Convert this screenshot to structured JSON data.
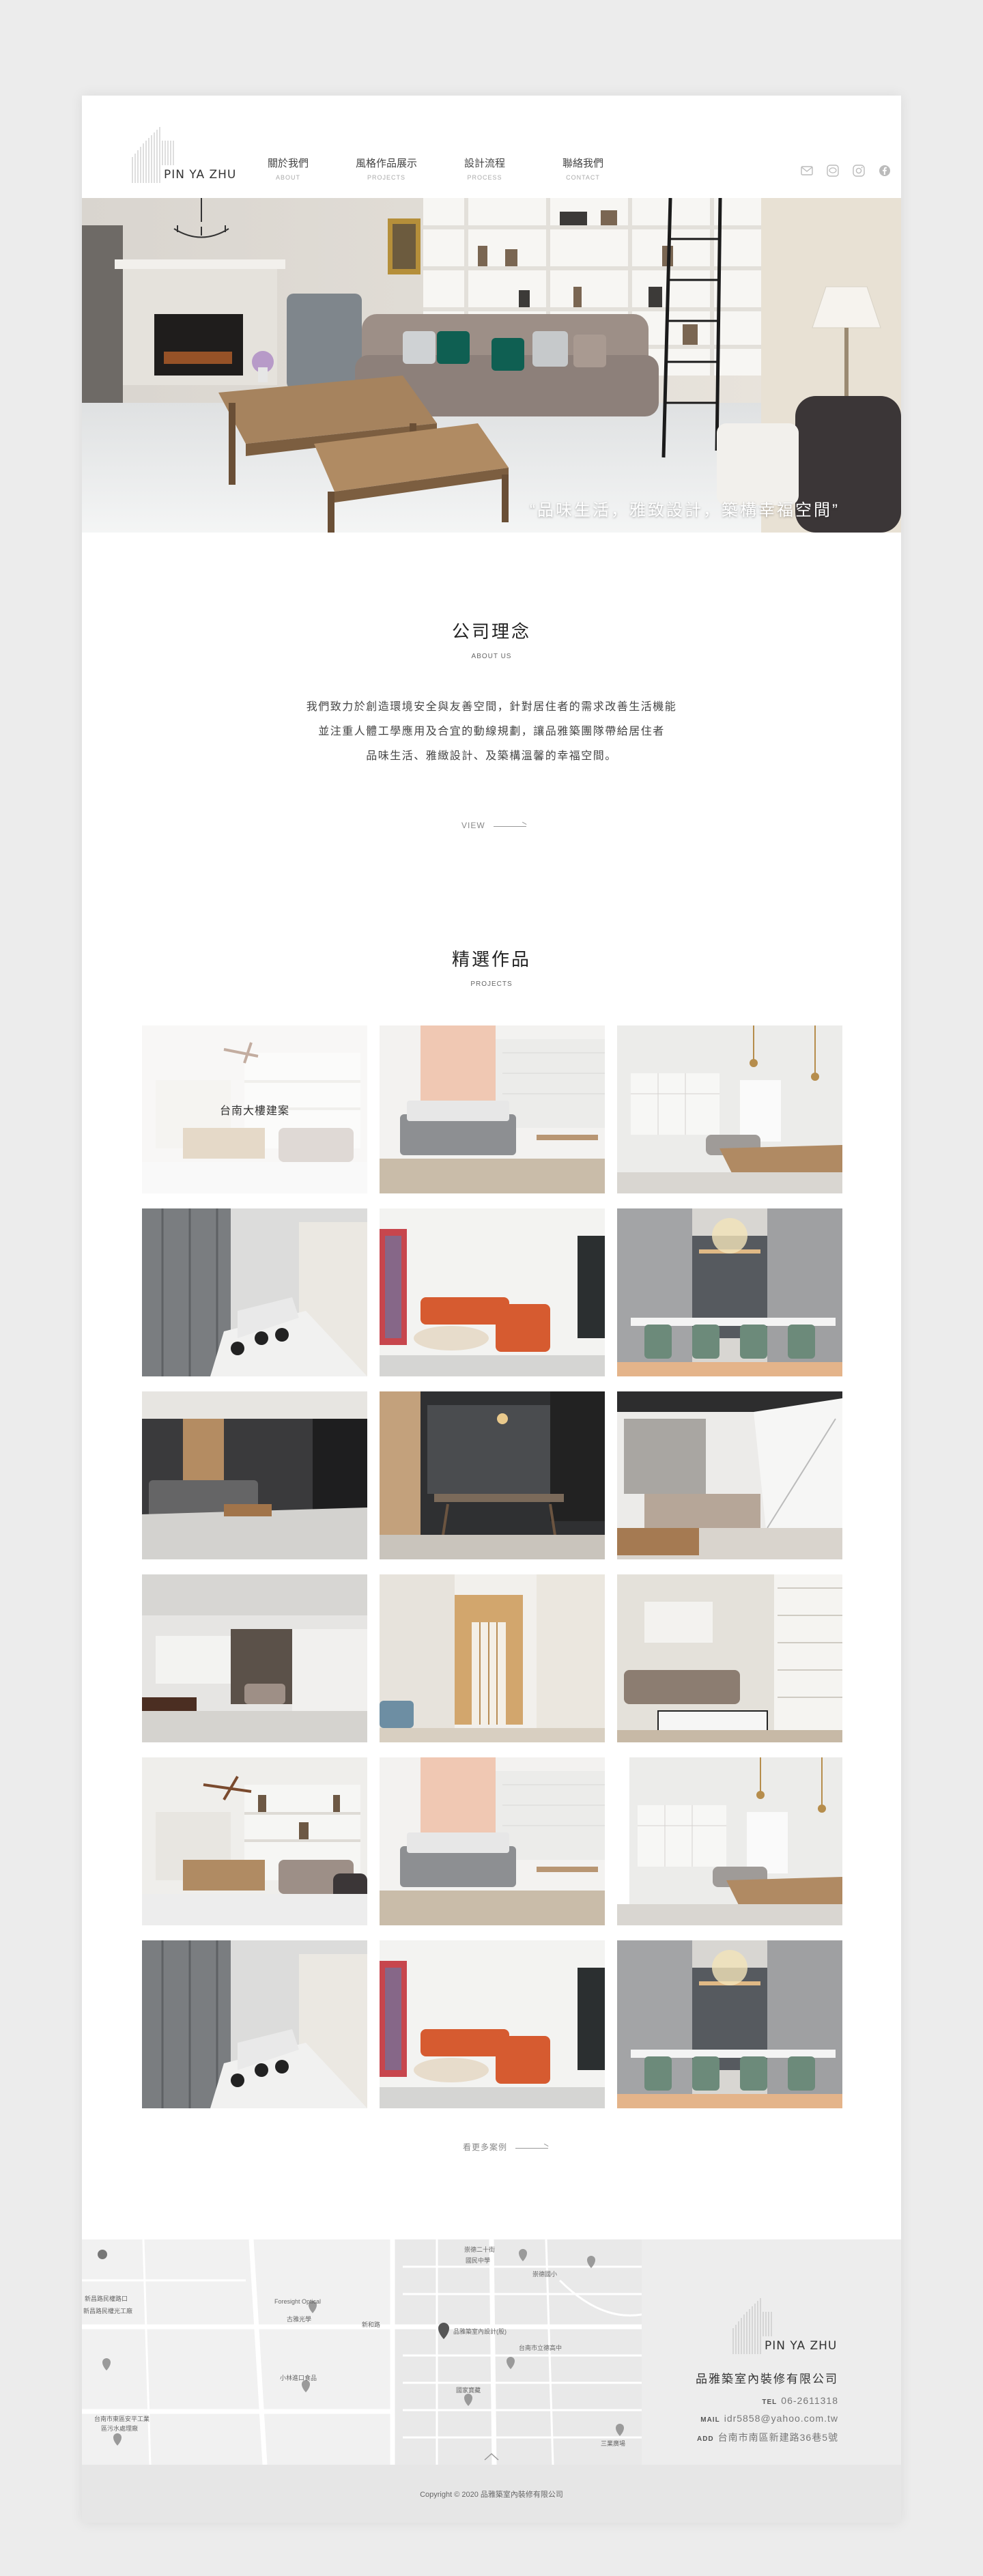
{
  "brand": {
    "logo_text": "PIN YA ZHU"
  },
  "nav": [
    {
      "zh": "關於我們",
      "en": "ABOUT"
    },
    {
      "zh": "風格作品展示",
      "en": "PROJECTS"
    },
    {
      "zh": "設計流程",
      "en": "PROCESS"
    },
    {
      "zh": "聯絡我們",
      "en": "CONTACT"
    }
  ],
  "socials": [
    "mail-icon",
    "line-icon",
    "instagram-icon",
    "facebook-icon"
  ],
  "hero": {
    "caption": "“品味生活，雅致設計，築構幸福空間”"
  },
  "about": {
    "title": "公司理念",
    "subtitle": "ABOUT US",
    "lines": [
      "我們致力於創造環境安全與友善空間，針對居住者的需求改善生活機能",
      "並注重人體工學應用及合宜的動線規劃，讓品雅築團隊帶給居住者",
      "品味生活、雅緻設計、及築構溫馨的幸福空間。"
    ],
    "more": "VIEW"
  },
  "projects": {
    "title": "精選作品",
    "subtitle": "PROJECTS",
    "featured_label": "台南大樓建案",
    "more": "看更多案例"
  },
  "map_labels": [
    "新昌路民權路口",
    "新昌路民權光工廠",
    "Foresight Optical",
    "古雅光學",
    "新和路",
    "小林進口食品",
    "台南市東區安平工業",
    "區污水處理廠",
    "崇德二十街",
    "國民中學",
    "崇德國小",
    "品雅築室內設計(股)",
    "國家寶藏",
    "台南市立德高中",
    "三業廣場"
  ],
  "contact": {
    "company": "品雅築室內裝修有限公司",
    "tel_key": "TEL",
    "tel": "06-2611318",
    "mail_key": "MAIL",
    "mail": "idr5858@yahoo.com.tw",
    "addr_key": "ADD",
    "addr": "台南市南區新建路36巷5號"
  },
  "footer": {
    "copyright": "Copyright © 2020 品雅築室內裝修有限公司"
  }
}
